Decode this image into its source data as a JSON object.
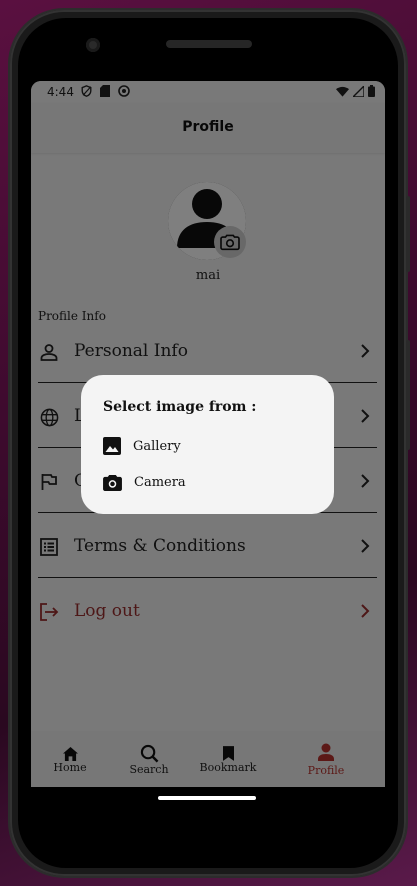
{
  "status_bar": {
    "time": "4:44"
  },
  "app_bar": {
    "title": "Profile"
  },
  "profile": {
    "username": "mai"
  },
  "section": {
    "label": "Profile Info"
  },
  "menu": {
    "items": [
      {
        "label": "Personal Info",
        "icon": "person-outline-icon"
      },
      {
        "label": "L",
        "icon": "globe-icon"
      },
      {
        "label": "C",
        "icon": "flag-icon"
      },
      {
        "label": "Terms & Conditions",
        "icon": "list-alt-icon"
      },
      {
        "label": "Log out",
        "icon": "logout-icon"
      }
    ]
  },
  "dialog": {
    "title": "Select image from :",
    "options": [
      {
        "label": "Gallery",
        "icon": "image-icon"
      },
      {
        "label": "Camera",
        "icon": "camera-icon"
      }
    ]
  },
  "bottom_nav": {
    "items": [
      {
        "label": "Home",
        "icon": "home-icon"
      },
      {
        "label": "Search",
        "icon": "search-icon"
      },
      {
        "label": "Bookmark",
        "icon": "bookmark-icon"
      },
      {
        "label": "Profile",
        "icon": "person-icon",
        "active": true
      }
    ]
  },
  "colors": {
    "accent": "#b8332e",
    "logout": "#9b2e2e",
    "scrim": "#000000"
  }
}
